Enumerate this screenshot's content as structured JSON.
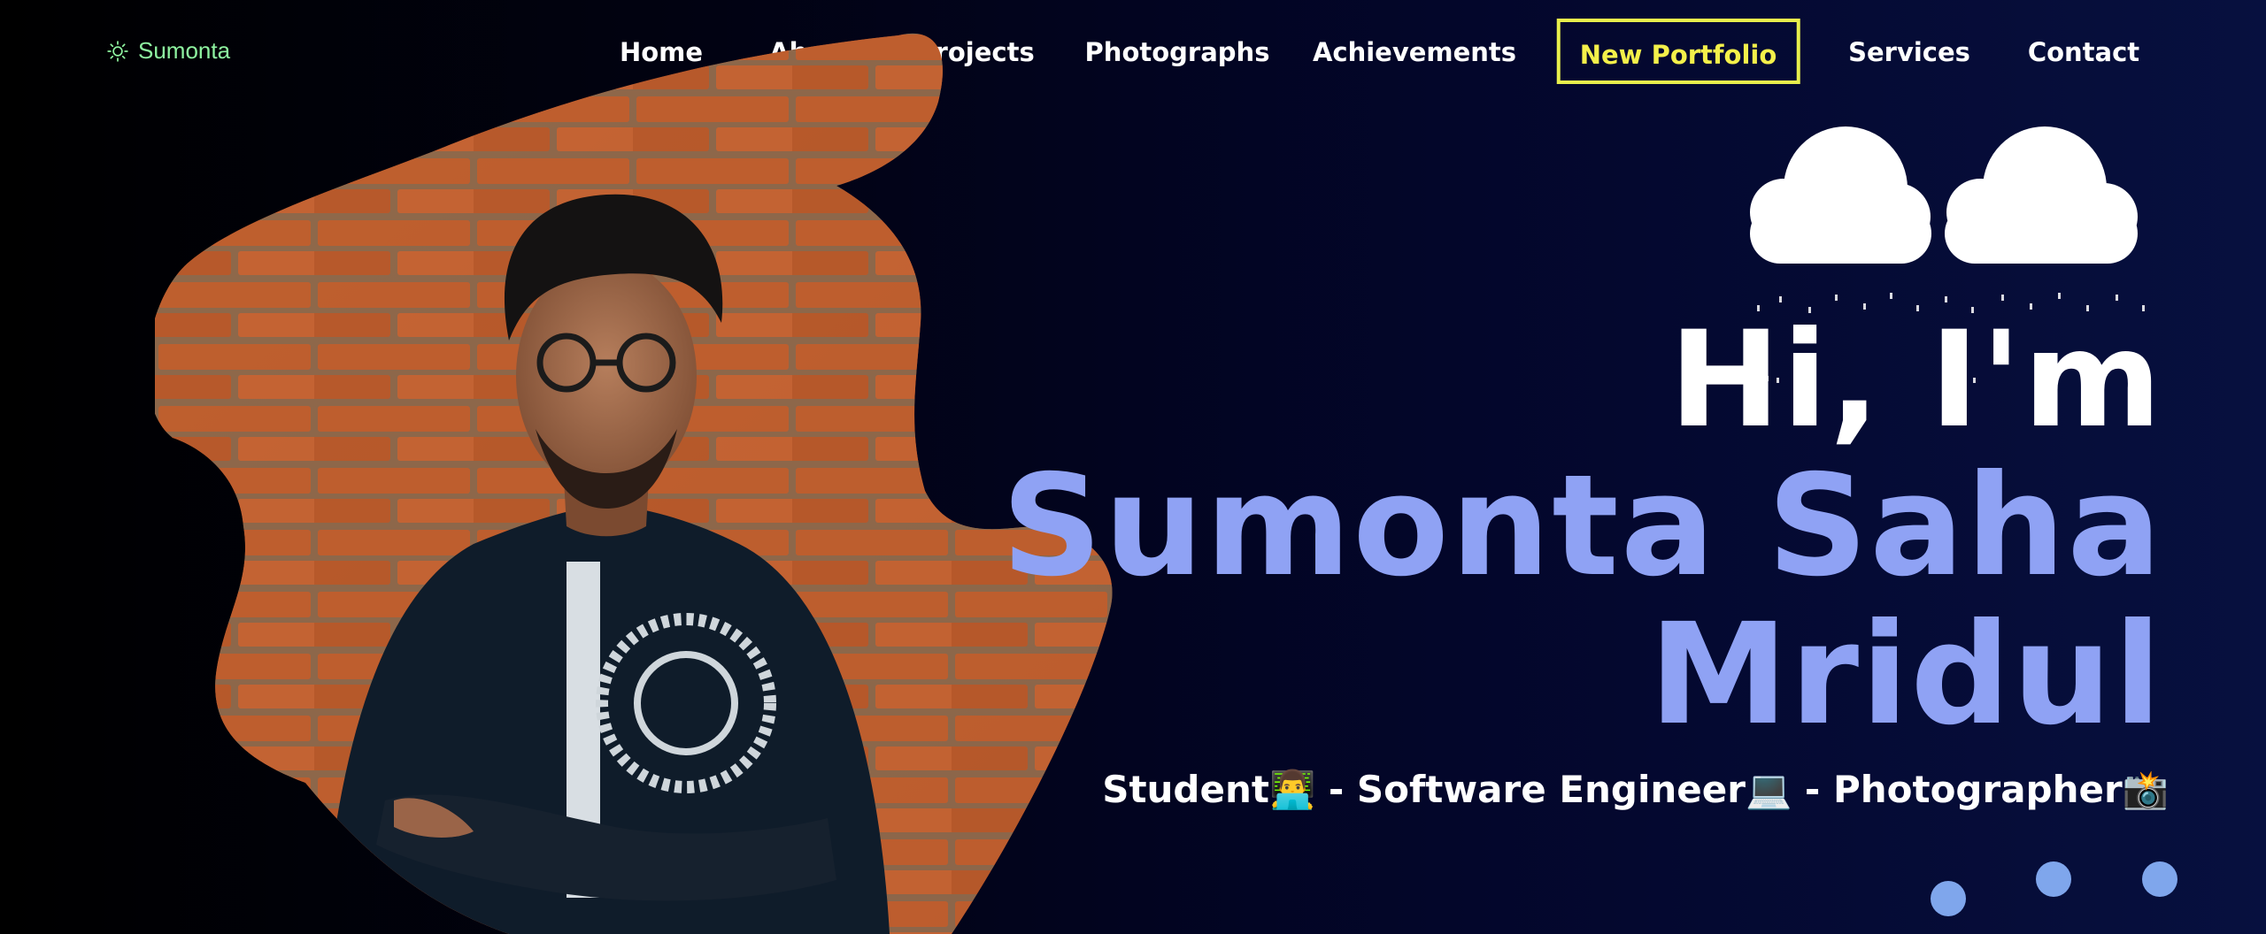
{
  "brand": {
    "label": "Sumonta",
    "icon": "bulb-icon",
    "color": "#8ef3a0"
  },
  "nav": {
    "items": [
      {
        "label": "Home"
      },
      {
        "label": "About"
      },
      {
        "label": "Projects"
      },
      {
        "label": "Photographs"
      },
      {
        "label": "Achievements"
      },
      {
        "label": "New Portfolio",
        "highlight_color": "#f4f04a"
      },
      {
        "label": "Services"
      },
      {
        "label": "Contact"
      }
    ]
  },
  "hero": {
    "greeting": "Hi, I'm",
    "name_line1": "Sumonta Saha",
    "name_line2": "Mridul",
    "tagline": "Student👨‍💻 - Software Engineer💻 - Photographer📸",
    "name_color": "#8fa2f4"
  },
  "portrait": {
    "icon": "profile-photo",
    "background": "brick-wall"
  },
  "weather": {
    "icon": "cloud-rain-icon"
  },
  "dots": {
    "count": 3,
    "color": "#7fa6ec"
  }
}
